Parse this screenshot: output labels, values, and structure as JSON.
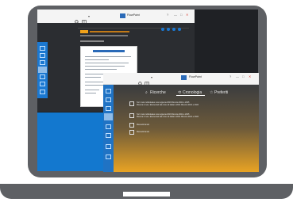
{
  "window_top": {
    "app_name": "FlowPaint",
    "close_glyph": "✕",
    "help_glyph": "?",
    "minimize_glyph": "—",
    "maximize_glyph": "□"
  },
  "window_bottom": {
    "app_name": "FlowPaint",
    "tabs": [
      "Ricerche",
      "Cronologia",
      "Preferiti"
    ],
    "active_tab": "Cronologia",
    "history_items": [
      {
        "title": "Term rule individuales sono appena 2019 Ricerca 2022 e 2025",
        "subtitle": "Ricerca in rete. Elementari dal corso di italiano 2021 Ricerca 2021 e 2024"
      },
      {
        "title": "Term rule individuales sono appena 2019 Ricerca 2022 e 2025",
        "subtitle": "Ricerca in rete. Elementari dal corso di italiano 2021 Ricerca 2021 e 2024"
      },
      {
        "title": "Manualizzando",
        "subtitle": ""
      },
      {
        "title": "Manualizzando",
        "subtitle": ""
      }
    ]
  },
  "icons": {
    "search": "search-icon",
    "book": "book-icon",
    "bookmark": "bookmark-icon",
    "history": "history-icon",
    "gear": "gear-icon"
  },
  "colors": {
    "laptop_frame": "#5e6064",
    "accent_blue": "#1b78d1",
    "accent_orange": "#e8a324"
  }
}
